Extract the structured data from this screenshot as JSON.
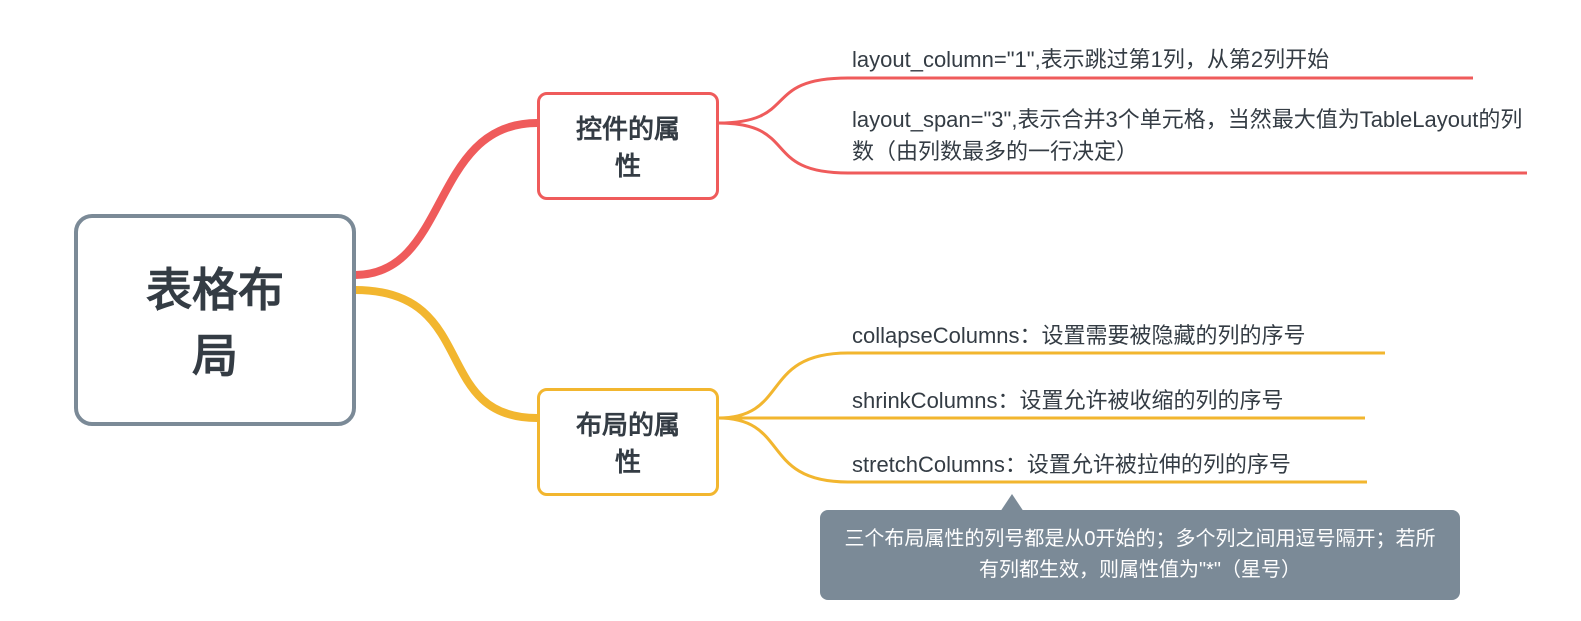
{
  "colors": {
    "root_border": "#7b8a97",
    "branch1": "#ef5b5b",
    "branch2": "#f2b62f",
    "text": "#343c44",
    "note_bg": "#7b8a97"
  },
  "root": {
    "title": "表格布局"
  },
  "branches": [
    {
      "label": "控件的属性",
      "leaves": [
        {
          "text": "layout_column=\"1\",表示跳过第1列，从第2列开始"
        },
        {
          "text": "layout_span=\"3\",表示合并3个单元格，当然最大值为TableLayout的列数（由列数最多的一行决定）"
        }
      ]
    },
    {
      "label": "布局的属性",
      "leaves": [
        {
          "text": "collapseColumns：设置需要被隐藏的列的序号"
        },
        {
          "text": "shrinkColumns：设置允许被收缩的列的序号"
        },
        {
          "text": "stretchColumns：设置允许被拉伸的列的序号"
        }
      ]
    }
  ],
  "note": {
    "text": "三个布局属性的列号都是从0开始的；多个列之间用逗号隔开；若所有列都生效，则属性值为\"*\"（星号）"
  }
}
